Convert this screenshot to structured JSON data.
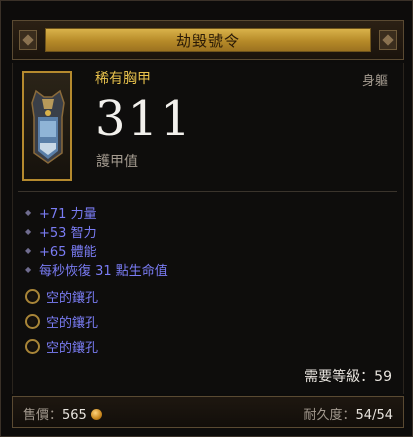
{
  "item": {
    "name": "劫毀號令",
    "rarity": "稀有胸甲",
    "slot": "身軀",
    "armor_value": "311",
    "armor_label": "護甲值",
    "stats": [
      "+71 力量",
      "+53 智力",
      "+65 體能",
      "每秒恢復 31 點生命值"
    ],
    "sockets": [
      "空的鑲孔",
      "空的鑲孔",
      "空的鑲孔"
    ],
    "required_level_label": "需要等級：",
    "required_level": "59"
  },
  "footer": {
    "price_label": "售價：",
    "price": "565",
    "durability_label": "耐久度：",
    "durability": "54/54"
  },
  "colors": {
    "title_bar": "#c89a34",
    "rarity": "#e6c04c",
    "magic_stat": "#7a7cf4",
    "socket_ring": "#a88538"
  },
  "icons": {
    "item_image": "chest-armor-icon",
    "socket": "socket-ring-icon",
    "gold": "gold-coin-icon",
    "bullet": "diamond-bullet-icon"
  }
}
